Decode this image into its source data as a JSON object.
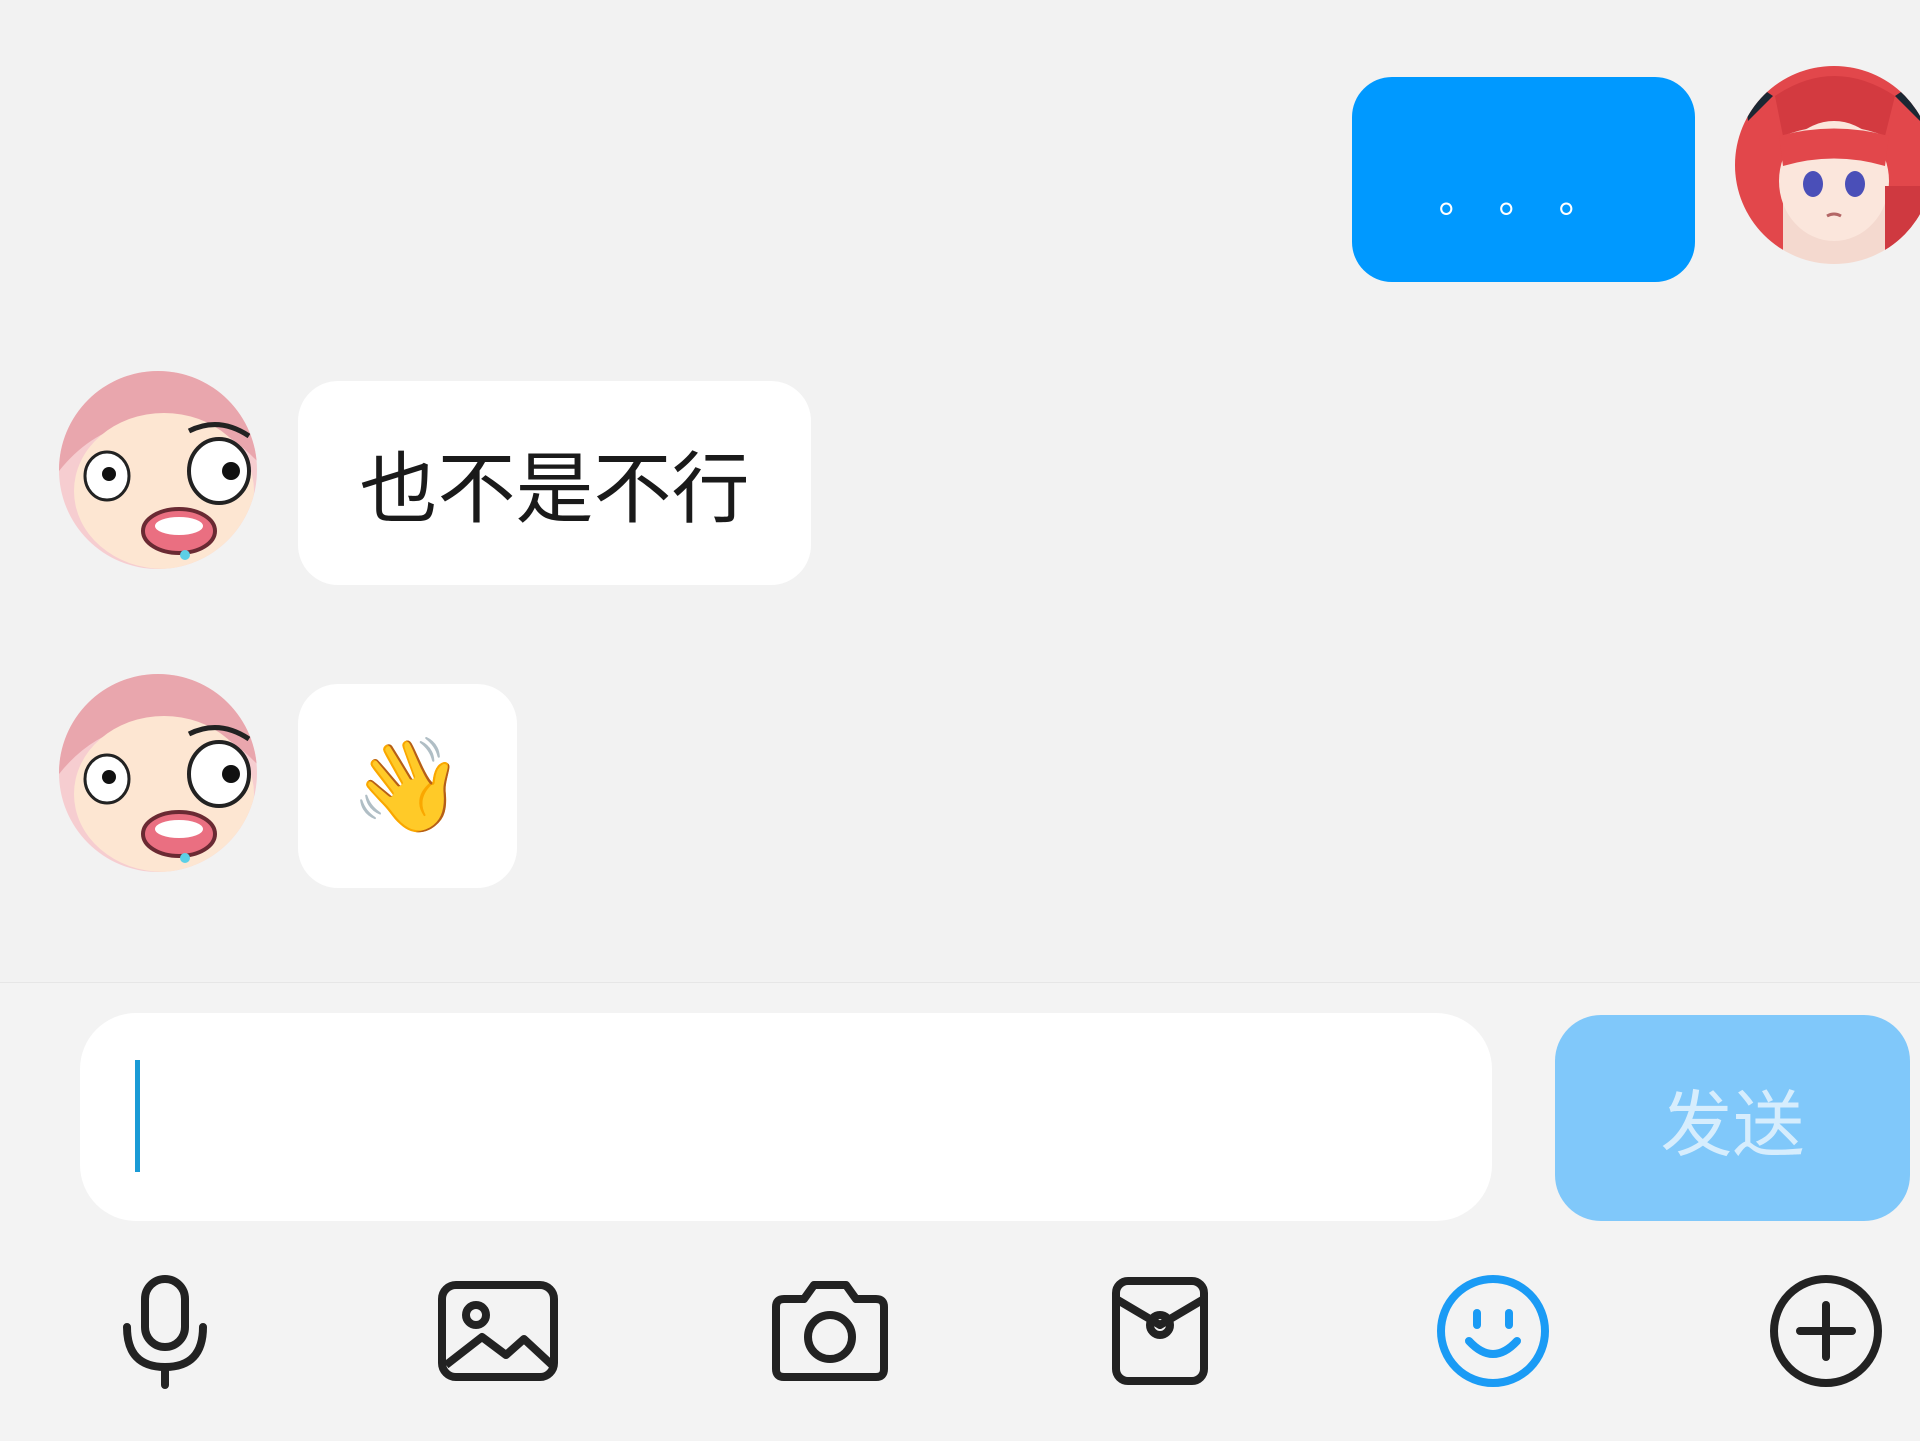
{
  "conversation": {
    "messages": [
      {
        "sender": "self",
        "text": "。。。"
      },
      {
        "sender": "other",
        "text": "也不是不行"
      },
      {
        "sender": "other",
        "text": "👋"
      }
    ]
  },
  "composer": {
    "input_value": "",
    "send_label": "发送"
  },
  "toolbar": {
    "icons": [
      "microphone-icon",
      "image-icon",
      "camera-icon",
      "red-packet-icon",
      "emoji-icon",
      "plus-icon"
    ]
  },
  "colors": {
    "outgoing_bubble": "#0099ff",
    "incoming_bubble": "#ffffff",
    "send_button_disabled": "#80c8fa",
    "active_icon": "#1a9bf5",
    "background": "#f2f2f2"
  }
}
